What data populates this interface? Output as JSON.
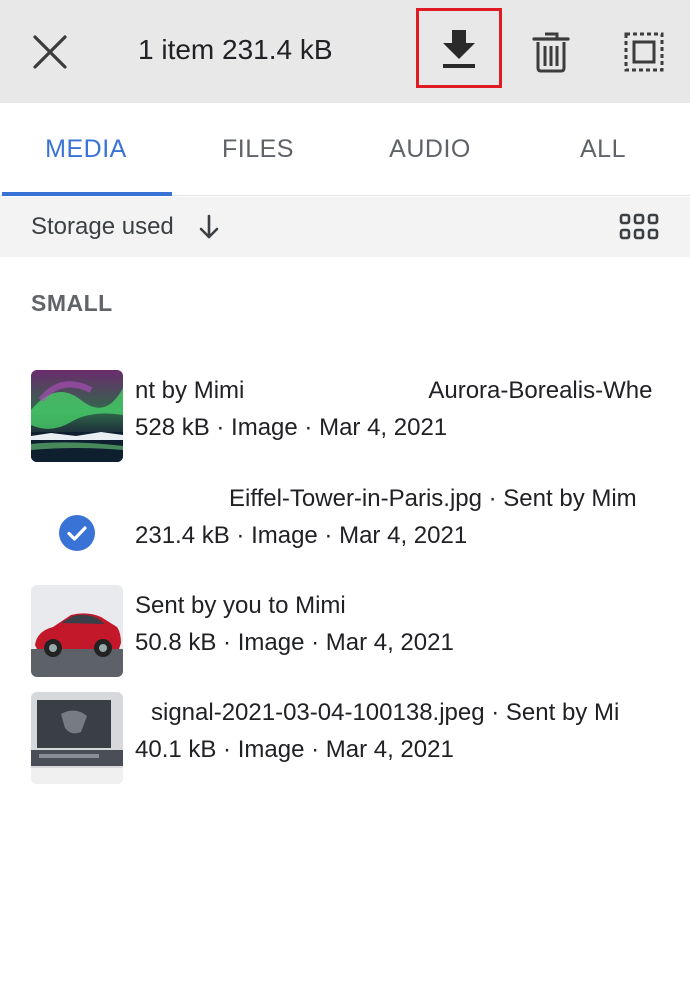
{
  "selection_bar": {
    "title": "1 item 231.4 kB",
    "icons": [
      "close-icon",
      "download-icon",
      "trash-icon",
      "select-all-icon"
    ]
  },
  "tabs": [
    {
      "label": "MEDIA",
      "active": true
    },
    {
      "label": "FILES",
      "active": false
    },
    {
      "label": "AUDIO",
      "active": false
    },
    {
      "label": "ALL",
      "active": false
    }
  ],
  "sort": {
    "label": "Storage used",
    "direction_icon": "arrow-down-icon",
    "view_icon": "grid-view-icon"
  },
  "section": {
    "title": "SMALL"
  },
  "items": [
    {
      "title": "Aurora-Borealis-Whe...jpg · Sent by Mimi",
      "visible_start": "nt by Mimi",
      "visible_end": "Aurora-Borealis-Whe",
      "meta": "528 kB · Image · Mar 4, 2021",
      "thumbnail": "aurora-image",
      "selected": false
    },
    {
      "title": "Eiffel-Tower-in-Paris.jpg · Sent by Mim",
      "meta": "231.4 kB · Image · Mar 4, 2021",
      "thumbnail": "check-icon",
      "selected": true
    },
    {
      "title": "Sent by you to Mimi",
      "meta": "50.8 kB · Image · Mar 4, 2021",
      "thumbnail": "red-car-image",
      "selected": false
    },
    {
      "title": "signal-2021-03-04-100138.jpeg · Sent by Mi",
      "meta": "40.1 kB · Image · Mar 4, 2021",
      "thumbnail": "laptop-image",
      "selected": false
    }
  ],
  "colors": {
    "accent": "#3a73d6",
    "highlight_box": "#e01b24",
    "topbar_bg": "#e8e8e8",
    "sortbar_bg": "#f3f3f3"
  }
}
